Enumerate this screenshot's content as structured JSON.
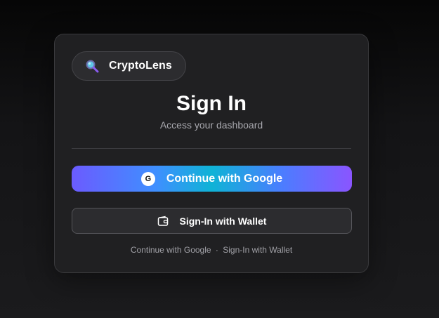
{
  "brand": {
    "name": "CryptoLens",
    "icon": "magnifier-icon"
  },
  "heading": {
    "title": "Sign In",
    "subtitle": "Access your dashboard"
  },
  "google_button": {
    "badge": "G",
    "label": "Continue with Google"
  },
  "wallet_button": {
    "icon": "wallet-icon",
    "label": "Sign-In with Wallet"
  },
  "footer": {
    "link_google": "Continue with Google",
    "separator": "·",
    "link_wallet": "Sign-In with Wallet"
  },
  "colors": {
    "background": "#1b1b1d",
    "card": "#202022",
    "accent_start": "#6b5bff",
    "accent_mid": "#0fb3d6",
    "accent_end": "#8a55ff"
  }
}
